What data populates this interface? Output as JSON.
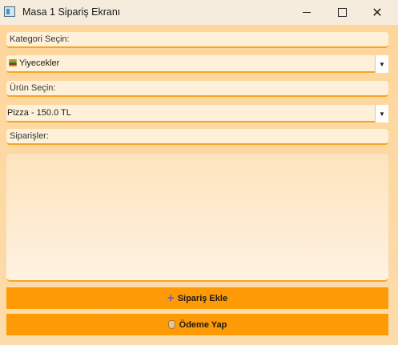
{
  "window": {
    "title": "Masa 1 Sipariş Ekranı",
    "close_glyph": "✕"
  },
  "category": {
    "label": "Kategori Seçin:",
    "selected_icon": "hamburger-icon",
    "selected_value": "Yiyecekler"
  },
  "product": {
    "label": "Ürün Seçin:",
    "selected_value": "Pizza - 150.0 TL"
  },
  "orders": {
    "label": "Siparişler:",
    "items": []
  },
  "actions": {
    "add_order_icon": "plus-icon",
    "add_order": "Sipariş Ekle",
    "pay_icon": "money-bag-icon",
    "pay": "Ödeme Yap"
  },
  "colors": {
    "background": "#fdd8a0",
    "accent": "#f5a623",
    "button": "#fd9a05",
    "field": "#fff1d9"
  }
}
